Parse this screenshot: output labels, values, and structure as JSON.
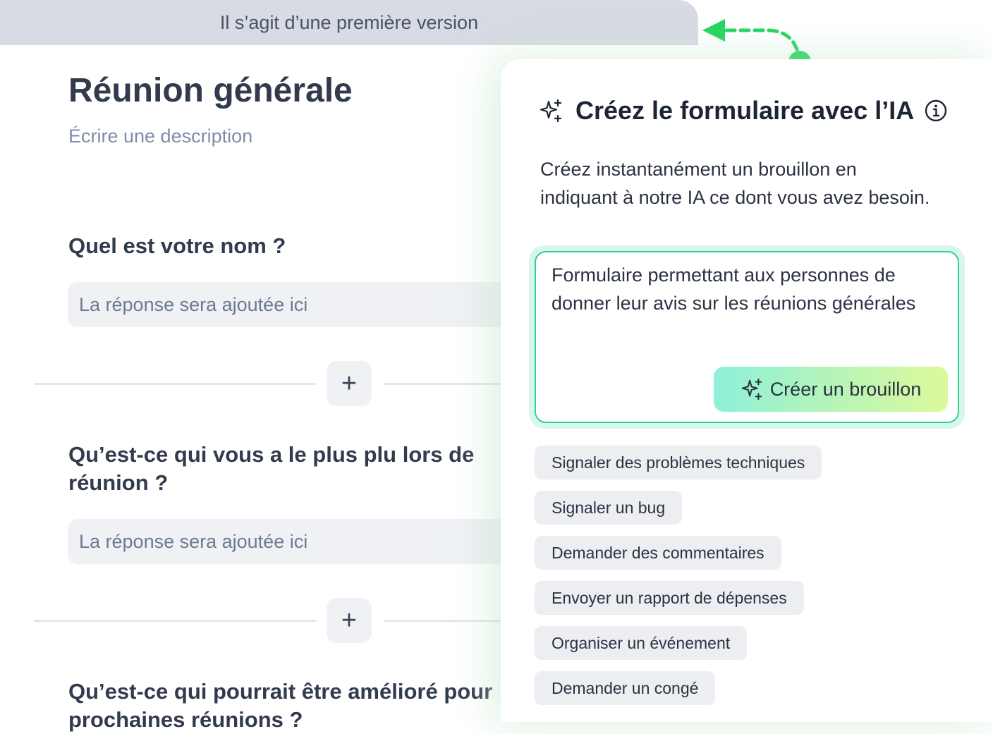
{
  "banner": {
    "text": "Il s’agit d’une première version",
    "arrow_color": "#22d45e"
  },
  "form": {
    "title": "Réunion générale",
    "description_placeholder": "Écrire une description",
    "questions": [
      {
        "label": "Quel est votre nom ?",
        "answer_placeholder": "La réponse sera ajoutée ici"
      },
      {
        "label": "Qu’est-ce qui vous a le plus plu lors de réunion ?",
        "answer_placeholder": "La réponse sera ajoutée ici"
      },
      {
        "label": "Qu’est-ce qui pourrait être amélioré pour prochaines réunions ?"
      }
    ],
    "add_label": "+"
  },
  "ai_panel": {
    "title": "Créez le formulaire avec l’IA",
    "icon": "sparkle-icon",
    "info_icon": "info-icon",
    "description": "Créez instantanément un brouillon en indiquant à notre IA ce dont vous avez besoin.",
    "prompt_value": "Formulaire permettant aux personnes de donner leur avis sur les réunions générales",
    "create_button": "Créer un brouillon",
    "accent": "#2ad489",
    "suggestions": [
      "Signaler des problèmes techniques",
      "Signaler un bug",
      "Demander des commentaires",
      "Envoyer un rapport de dépenses",
      "Organiser un événement",
      "Demander un congé"
    ]
  }
}
